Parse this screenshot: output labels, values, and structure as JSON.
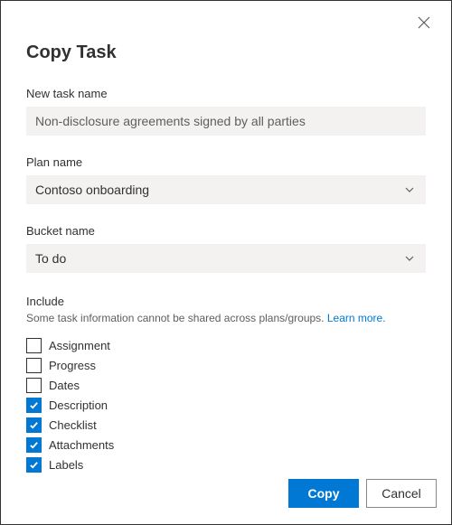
{
  "dialog": {
    "title": "Copy Task"
  },
  "taskName": {
    "label": "New task name",
    "value": "Non-disclosure agreements signed by all parties"
  },
  "planName": {
    "label": "Plan name",
    "value": "Contoso onboarding"
  },
  "bucketName": {
    "label": "Bucket name",
    "value": "To do"
  },
  "include": {
    "label": "Include",
    "note": "Some task information cannot be shared across plans/groups. ",
    "learnMore": "Learn more.",
    "items": [
      {
        "label": "Assignment",
        "checked": false
      },
      {
        "label": "Progress",
        "checked": false
      },
      {
        "label": "Dates",
        "checked": false
      },
      {
        "label": "Description",
        "checked": true
      },
      {
        "label": "Checklist",
        "checked": true
      },
      {
        "label": "Attachments",
        "checked": true
      },
      {
        "label": "Labels",
        "checked": true
      }
    ]
  },
  "buttons": {
    "copy": "Copy",
    "cancel": "Cancel"
  }
}
